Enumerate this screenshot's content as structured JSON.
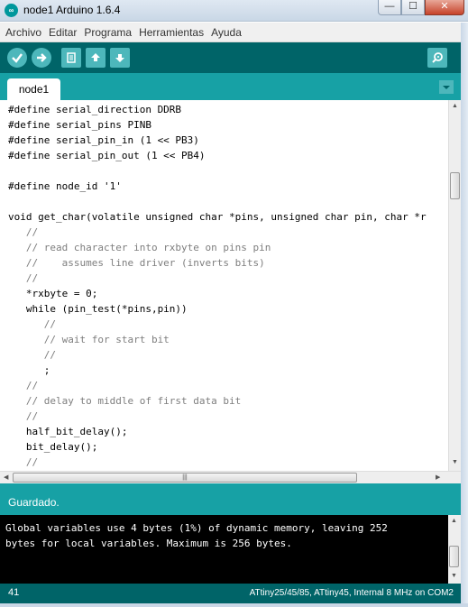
{
  "window": {
    "title": "node1 Arduino 1.6.4",
    "app_icon": "arduino-logo-icon",
    "minimize": "—",
    "maximize": "☐",
    "close": "✕"
  },
  "menu": {
    "items": [
      "Archivo",
      "Editar",
      "Programa",
      "Herramientas",
      "Ayuda"
    ]
  },
  "toolbar": {
    "buttons": [
      "verify-icon",
      "upload-icon",
      "new-icon",
      "open-icon",
      "save-icon"
    ],
    "serial_monitor": "serial-monitor-icon"
  },
  "tabs": {
    "active": "node1",
    "menu_icon": "tab-dropdown-icon"
  },
  "editor": {
    "lines": [
      "#define serial_direction DDRB",
      "#define serial_pins PINB",
      "#define serial_pin_in (1 << PB3)",
      "#define serial_pin_out (1 << PB4)",
      "",
      "#define node_id '1'",
      "",
      "void get_char(volatile unsigned char *pins, unsigned char pin, char *r",
      "   //",
      "   // read character into rxbyte on pins pin",
      "   //    assumes line driver (inverts bits)",
      "   //",
      "   *rxbyte = 0;",
      "   while (pin_test(*pins,pin))",
      "      //",
      "      // wait for start bit",
      "      //",
      "      ;",
      "   //",
      "   // delay to middle of first data bit",
      "   //",
      "   half_bit_delay();",
      "   bit_delay();",
      "   //"
    ]
  },
  "status": {
    "message": "Guardado."
  },
  "console": {
    "lines": [
      "Global variables use 4 bytes (1%) of dynamic memory, leaving 252",
      "bytes for local variables. Maximum is 256 bytes."
    ]
  },
  "footer": {
    "line_number": "41",
    "board": "ATtiny25/45/85, ATtiny45, Internal 8 MHz on COM2"
  },
  "colors": {
    "toolbar": "#006468",
    "tabstrip": "#17a1a5",
    "keyword": "#cc6600",
    "comment": "#7e7e7e"
  }
}
